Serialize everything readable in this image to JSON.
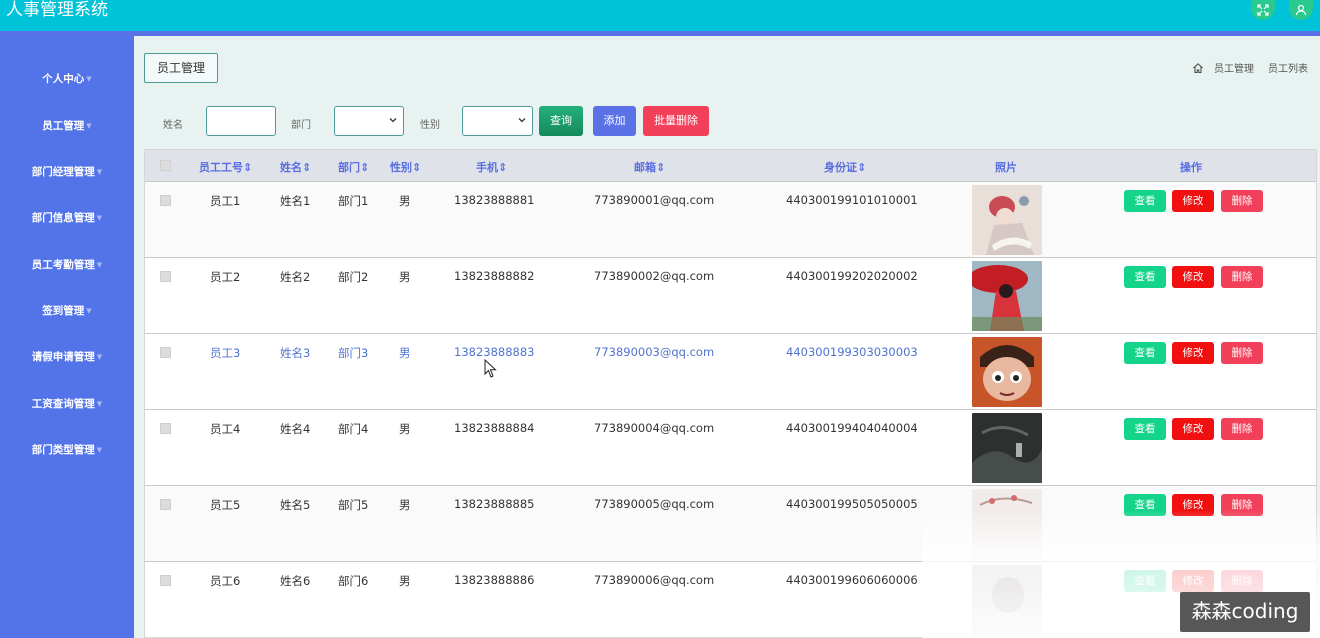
{
  "app": {
    "title": "人事管理系统"
  },
  "colors": {
    "header": "#00c2d8",
    "sidebar": "#5274e8",
    "accent": "#5a6ee0",
    "view": "#14d48c",
    "edit": "#f01010",
    "delete": "#f2405a",
    "search": "#1f9f6e",
    "add": "#5a72e6"
  },
  "header": {
    "icons": [
      "fullscreen-icon",
      "user-icon"
    ]
  },
  "sidebar": {
    "items": [
      {
        "label": "个人中心"
      },
      {
        "label": "员工管理"
      },
      {
        "label": "部门经理管理"
      },
      {
        "label": "部门信息管理"
      },
      {
        "label": "员工考勤管理"
      },
      {
        "label": "签到管理"
      },
      {
        "label": "请假申请管理"
      },
      {
        "label": "工资查询管理"
      },
      {
        "label": "部门类型管理"
      }
    ]
  },
  "page": {
    "tag": "员工管理",
    "breadcrumb": [
      "员工管理",
      "员工列表"
    ]
  },
  "filters": {
    "name_label": "姓名",
    "name_value": "",
    "dept_label": "部门",
    "dept_value": "",
    "gender_label": "性别",
    "gender_value": "",
    "search_label": "查询",
    "add_label": "添加",
    "batch_delete_label": "批量删除"
  },
  "table": {
    "columns": [
      "员工工号",
      "姓名",
      "部门",
      "性别",
      "手机",
      "邮箱",
      "身份证",
      "照片",
      "操作"
    ],
    "sortable": [
      true,
      true,
      true,
      true,
      true,
      true,
      true,
      false,
      false
    ],
    "sort_icon": "sort-icon",
    "actions": {
      "view": "查看",
      "edit": "修改",
      "delete": "删除"
    },
    "rows": [
      {
        "id": "员工1",
        "name": "姓名1",
        "dept": "部门1",
        "gender": "男",
        "phone": "13823888881",
        "email": "773890001@qq.com",
        "idcard": "440300199101010001",
        "photo": "opera-figure-photo",
        "highlighted": false
      },
      {
        "id": "员工2",
        "name": "姓名2",
        "dept": "部门2",
        "gender": "男",
        "phone": "13823888882",
        "email": "773890002@qq.com",
        "idcard": "440300199202020002",
        "photo": "red-umbrella-photo",
        "highlighted": false
      },
      {
        "id": "员工3",
        "name": "姓名3",
        "dept": "部门3",
        "gender": "男",
        "phone": "13823888883",
        "email": "773890003@qq.com",
        "idcard": "440300199303030003",
        "photo": "animated-character-photo",
        "highlighted": true
      },
      {
        "id": "员工4",
        "name": "姓名4",
        "dept": "部门4",
        "gender": "男",
        "phone": "13823888884",
        "email": "773890004@qq.com",
        "idcard": "440300199404040004",
        "photo": "dark-landscape-photo",
        "highlighted": false
      },
      {
        "id": "员工5",
        "name": "姓名5",
        "dept": "部门5",
        "gender": "男",
        "phone": "13823888885",
        "email": "773890005@qq.com",
        "idcard": "440300199505050005",
        "photo": "blossom-photo",
        "highlighted": false
      },
      {
        "id": "员工6",
        "name": "姓名6",
        "dept": "部门6",
        "gender": "男",
        "phone": "13823888886",
        "email": "773890006@qq.com",
        "idcard": "440300199606060006",
        "photo": "faded-portrait-photo",
        "highlighted": false
      }
    ]
  },
  "watermark": {
    "text": "森森coding"
  }
}
